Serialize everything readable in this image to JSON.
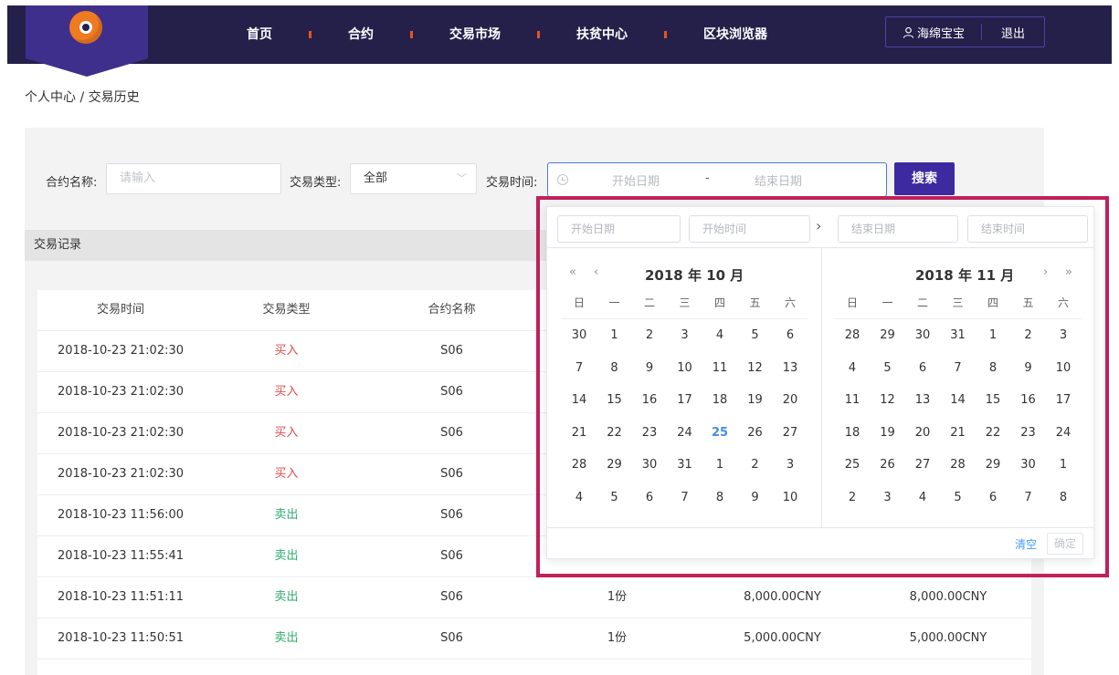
{
  "nav": {
    "items": [
      "首页",
      "合约",
      "交易市场",
      "扶贫中心",
      "区块浏览器"
    ],
    "user_name": "海绵宝宝",
    "logout": "退出"
  },
  "breadcrumb": "个人中心 / 交易历史",
  "filters": {
    "contract_label": "合约名称:",
    "contract_placeholder": "请输入",
    "type_label": "交易类型:",
    "type_value": "全部",
    "time_label": "交易时间:",
    "start_placeholder": "开始日期",
    "separator": "-",
    "end_placeholder": "结束日期",
    "search_button": "搜索"
  },
  "section_title": "交易记录",
  "table": {
    "headers": [
      "交易时间",
      "交易类型",
      "合约名称"
    ],
    "rows": [
      {
        "time": "2018-10-23 21:02:30",
        "type": "买入",
        "kind": "buy",
        "contract": "S06",
        "qty": "",
        "price": "",
        "amount": ""
      },
      {
        "time": "2018-10-23 21:02:30",
        "type": "买入",
        "kind": "buy",
        "contract": "S06",
        "qty": "",
        "price": "",
        "amount": ""
      },
      {
        "time": "2018-10-23 21:02:30",
        "type": "买入",
        "kind": "buy",
        "contract": "S06",
        "qty": "",
        "price": "",
        "amount": ""
      },
      {
        "time": "2018-10-23 21:02:30",
        "type": "买入",
        "kind": "buy",
        "contract": "S06",
        "qty": "",
        "price": "",
        "amount": ""
      },
      {
        "time": "2018-10-23 11:56:00",
        "type": "卖出",
        "kind": "sell",
        "contract": "S06",
        "qty": "",
        "price": "",
        "amount": ""
      },
      {
        "time": "2018-10-23 11:55:41",
        "type": "卖出",
        "kind": "sell",
        "contract": "S06",
        "qty": "",
        "price": "",
        "amount": ""
      },
      {
        "time": "2018-10-23 11:51:11",
        "type": "卖出",
        "kind": "sell",
        "contract": "S06",
        "qty": "1份",
        "price": "8,000.00CNY",
        "amount": "8,000.00CNY"
      },
      {
        "time": "2018-10-23 11:50:51",
        "type": "卖出",
        "kind": "sell",
        "contract": "S06",
        "qty": "1份",
        "price": "5,000.00CNY",
        "amount": "5,000.00CNY"
      }
    ]
  },
  "picker": {
    "start_date": "开始日期",
    "start_time": "开始时间",
    "end_date": "结束日期",
    "end_time": "结束时间",
    "left_title": "2018 年 10 月",
    "right_title": "2018 年 11 月",
    "weekdays": [
      "日",
      "一",
      "二",
      "三",
      "四",
      "五",
      "六"
    ],
    "left_days": [
      [
        "30",
        "1",
        "2",
        "3",
        "4",
        "5",
        "6"
      ],
      [
        "7",
        "8",
        "9",
        "10",
        "11",
        "12",
        "13"
      ],
      [
        "14",
        "15",
        "16",
        "17",
        "18",
        "19",
        "20"
      ],
      [
        "21",
        "22",
        "23",
        "24",
        "25",
        "26",
        "27"
      ],
      [
        "28",
        "29",
        "30",
        "31",
        "1",
        "2",
        "3"
      ],
      [
        "4",
        "5",
        "6",
        "7",
        "8",
        "9",
        "10"
      ]
    ],
    "right_days": [
      [
        "28",
        "29",
        "30",
        "31",
        "1",
        "2",
        "3"
      ],
      [
        "4",
        "5",
        "6",
        "7",
        "8",
        "9",
        "10"
      ],
      [
        "11",
        "12",
        "13",
        "14",
        "15",
        "16",
        "17"
      ],
      [
        "18",
        "19",
        "20",
        "21",
        "22",
        "23",
        "24"
      ],
      [
        "25",
        "26",
        "27",
        "28",
        "29",
        "30",
        "1"
      ],
      [
        "2",
        "3",
        "4",
        "5",
        "6",
        "7",
        "8"
      ]
    ],
    "today": "25",
    "clear": "清空",
    "confirm": "确定",
    "nav_prev_year": "«",
    "nav_prev_month": "‹",
    "nav_next_month": "›",
    "nav_next_year": "»",
    "arrow": "›"
  },
  "colors": {
    "header_bg": "#25204a",
    "accent": "#3d2aa0",
    "highlight_frame": "#c1205a",
    "buy": "#e14b4b",
    "sell": "#2cab6c",
    "today": "#3f8ef0"
  }
}
